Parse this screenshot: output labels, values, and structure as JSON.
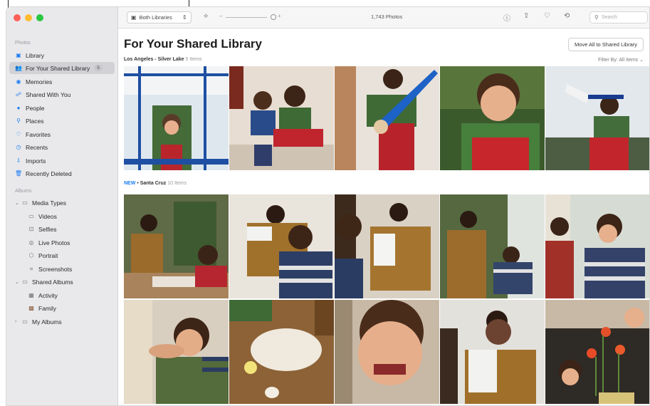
{
  "sidebar": {
    "section_photos": "Photos",
    "items_photos": [
      {
        "label": "Library",
        "icon": "library-icon"
      },
      {
        "label": "For Your Shared Library",
        "icon": "shared-library-icon",
        "badge": "5",
        "selected": true
      },
      {
        "label": "Memories",
        "icon": "memories-icon"
      },
      {
        "label": "Shared With You",
        "icon": "shared-with-you-icon"
      },
      {
        "label": "People",
        "icon": "people-icon"
      },
      {
        "label": "Places",
        "icon": "places-icon"
      },
      {
        "label": "Favorites",
        "icon": "heart-icon"
      },
      {
        "label": "Recents",
        "icon": "clock-icon"
      },
      {
        "label": "Imports",
        "icon": "import-icon"
      },
      {
        "label": "Recently Deleted",
        "icon": "trash-icon"
      }
    ],
    "section_albums": "Albums",
    "media_types": "Media Types",
    "media_items": [
      "Videos",
      "Selfies",
      "Live Photos",
      "Portrait",
      "Screenshots"
    ],
    "shared_albums": "Shared Albums",
    "shared_items": [
      "Activity",
      "Family"
    ],
    "my_albums": "My Albums"
  },
  "toolbar": {
    "library_selector": "Both Libraries",
    "photo_count": "1,743 Photos",
    "search_placeholder": "Search"
  },
  "main": {
    "title": "For Your Shared Library",
    "move_all_label": "Move All to Shared Library",
    "group1_place": "Los Angeles - Silver Lake",
    "group1_count": "5 Items",
    "filter_label": "Filter By: All Items",
    "group2_new": "NEW",
    "group2_place": "Santa Cruz",
    "group2_count": "10 Items"
  },
  "colors": {
    "accent": "#1a7cf2",
    "sidebar_bg": "#e9e9ec",
    "selection": "#d2d2d6"
  }
}
